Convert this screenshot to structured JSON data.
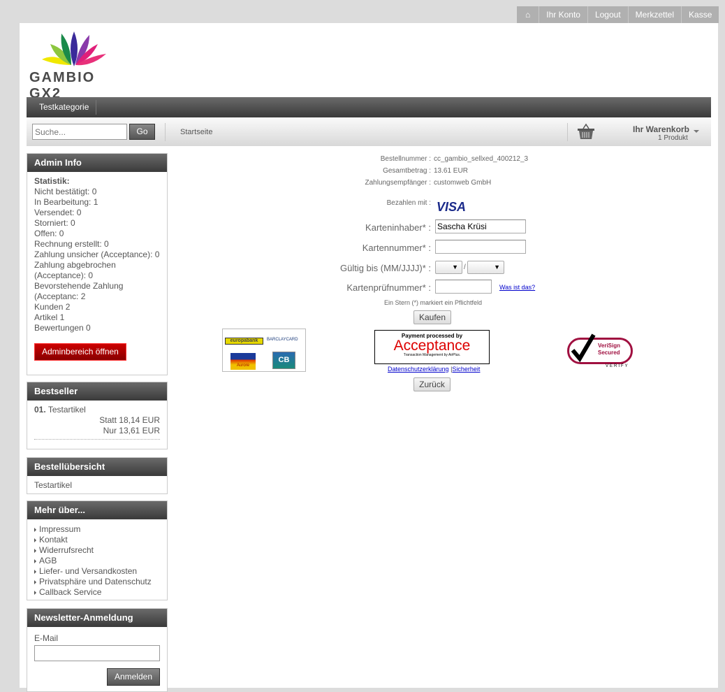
{
  "topnav": {
    "items": [
      "Ihr Konto",
      "Logout",
      "Merkzettel",
      "Kasse"
    ]
  },
  "logo": {
    "text": "GAMBIO GX2"
  },
  "categories": [
    "Testkategorie"
  ],
  "toolbar": {
    "search_placeholder": "Suche...",
    "go": "Go",
    "breadcrumb": "Startseite",
    "cart_title": "Ihr Warenkorb",
    "cart_count": "1 Produkt"
  },
  "sidebar": {
    "admin": {
      "title": "Admin Info",
      "heading": "Statistik:",
      "lines": [
        "Nicht bestätigt: 0",
        "In Bearbeitung: 1",
        "Versendet: 0",
        "Storniert: 0",
        "Offen: 0",
        "Rechnung erstellt: 0",
        "Zahlung unsicher (Acceptance): 0",
        "Zahlung abgebrochen (Acceptance): 0",
        "Bevorstehende Zahlung (Acceptanc: 2",
        "Kunden 2",
        "Artikel 1",
        "Bewertungen 0"
      ],
      "button": "Adminbereich öffnen"
    },
    "bestseller": {
      "title": "Bestseller",
      "rank": "01.",
      "name": "Testartikel",
      "old_price": "Statt 18,14 EUR",
      "price": "Nur 13,61 EUR"
    },
    "order": {
      "title": "Bestellübersicht",
      "item": "Testartikel"
    },
    "more": {
      "title": "Mehr über...",
      "links": [
        "Impressum",
        "Kontakt",
        "Widerrufsrecht",
        "AGB",
        "Liefer- und Versandkosten",
        "Privatsphäre und Datenschutz",
        "Callback Service"
      ]
    },
    "newsletter": {
      "title": "Newsletter-Anmeldung",
      "label": "E-Mail",
      "button": "Anmelden"
    }
  },
  "payment": {
    "order_label": "Bestellnummer :",
    "order_value": "cc_gambio_sellxed_400212_3",
    "total_label": "Gesamtbetrag :",
    "total_value": "13.61 EUR",
    "payee_label": "Zahlungsempfänger :",
    "payee_value": "customweb GmbH",
    "pay_with_label": "Bezahlen mit :",
    "card_brand": "VISA",
    "holder_label": "Karteninhaber* :",
    "holder_value": "Sascha Krüsi",
    "number_label": "Kartennummer* :",
    "number_value": "",
    "expiry_label": "Gültig bis (MM/JJJJ)* :",
    "expiry_sep": "/",
    "cvc_label": "Kartenprüfnummer* :",
    "cvc_help": "Was ist das?",
    "required_note": "Ein Stern (*) markiert ein Pflichtfeld",
    "buy": "Kaufen",
    "acceptance_top": "Payment processed by",
    "acceptance_name": "Acceptance",
    "acceptance_sub": "Transaction Management by AirPlus.",
    "privacy": "Datenschutzerklärung",
    "security": "Sicherheit",
    "back": "Zurück",
    "banks": [
      "europabank",
      "BARCLAYCARD",
      "Aurore",
      "CB"
    ],
    "verisign": [
      "VeriSign",
      "Secured",
      "VERIFY"
    ]
  }
}
